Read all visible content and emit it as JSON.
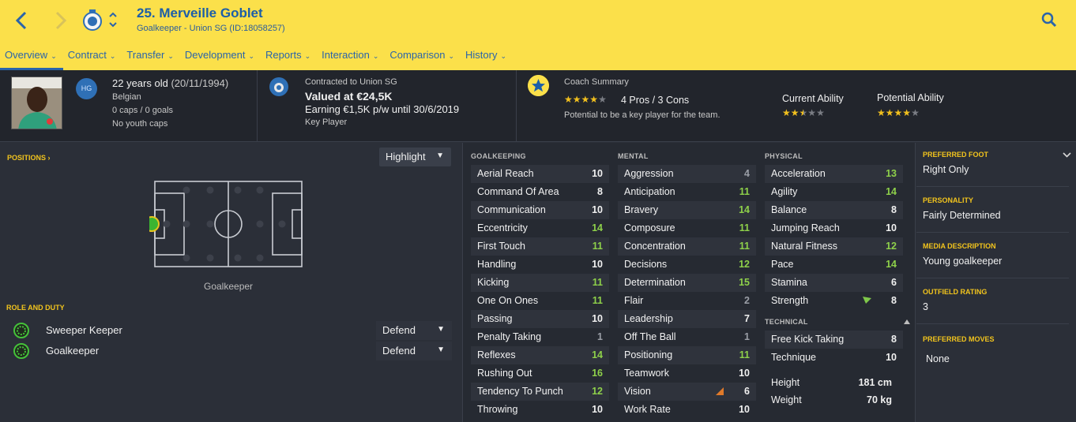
{
  "header": {
    "title": "25. Merveille Goblet",
    "subtitle": "Goalkeeper - Union SG (ID:18058257)",
    "tabs": [
      {
        "label": "Overview",
        "active": true
      },
      {
        "label": "Contract"
      },
      {
        "label": "Transfer"
      },
      {
        "label": "Development"
      },
      {
        "label": "Reports"
      },
      {
        "label": "Interaction"
      },
      {
        "label": "Comparison"
      },
      {
        "label": "History"
      }
    ],
    "accent": "#fbe04a"
  },
  "info": {
    "hg_badge": "HG",
    "age": "22 years old",
    "dob": "(20/11/1994)",
    "nationality": "Belgian",
    "caps": "0 caps / 0 goals",
    "youth_caps": "No youth caps",
    "contracted_to": "Contracted to Union SG",
    "value": "Valued at €24,5K",
    "earning": "Earning €1,5K p/w until 30/6/2019",
    "squad_status": "Key Player",
    "coach_summary_label": "Coach Summary",
    "coach_pros_cons": "4 Pros / 3 Cons",
    "coach_note": "Potential to be a key player for the team.",
    "coach_stars": 4,
    "current_ability_label": "Current Ability",
    "current_ability_stars": 2.5,
    "potential_ability_label": "Potential Ability",
    "potential_ability_stars": 4
  },
  "left": {
    "positions_label": "POSITIONS ›",
    "highlight_label": "Highlight",
    "position_name": "Goalkeeper",
    "role_label": "ROLE AND DUTY",
    "roles": [
      {
        "name": "Sweeper Keeper",
        "duty": "Defend"
      },
      {
        "name": "Goalkeeper",
        "duty": "Defend"
      }
    ]
  },
  "attributes": {
    "goalkeeping_label": "GOALKEEPING",
    "goalkeeping": [
      {
        "name": "Aerial Reach",
        "value": "10"
      },
      {
        "name": "Command Of Area",
        "value": "8"
      },
      {
        "name": "Communication",
        "value": "10"
      },
      {
        "name": "Eccentricity",
        "value": "14"
      },
      {
        "name": "First Touch",
        "value": "11"
      },
      {
        "name": "Handling",
        "value": "10"
      },
      {
        "name": "Kicking",
        "value": "11"
      },
      {
        "name": "One On Ones",
        "value": "11"
      },
      {
        "name": "Passing",
        "value": "10"
      },
      {
        "name": "Penalty Taking",
        "value": "1"
      },
      {
        "name": "Reflexes",
        "value": "14"
      },
      {
        "name": "Rushing Out",
        "value": "16"
      },
      {
        "name": "Tendency To Punch",
        "value": "12"
      },
      {
        "name": "Throwing",
        "value": "10"
      }
    ],
    "mental_label": "MENTAL",
    "mental": [
      {
        "name": "Aggression",
        "value": "4"
      },
      {
        "name": "Anticipation",
        "value": "11"
      },
      {
        "name": "Bravery",
        "value": "14"
      },
      {
        "name": "Composure",
        "value": "11"
      },
      {
        "name": "Concentration",
        "value": "11"
      },
      {
        "name": "Decisions",
        "value": "12"
      },
      {
        "name": "Determination",
        "value": "15"
      },
      {
        "name": "Flair",
        "value": "2"
      },
      {
        "name": "Leadership",
        "value": "7"
      },
      {
        "name": "Off The Ball",
        "value": "1"
      },
      {
        "name": "Positioning",
        "value": "11"
      },
      {
        "name": "Teamwork",
        "value": "10"
      },
      {
        "name": "Vision",
        "value": "6",
        "trend": "down"
      },
      {
        "name": "Work Rate",
        "value": "10"
      }
    ],
    "physical_label": "PHYSICAL",
    "physical": [
      {
        "name": "Acceleration",
        "value": "13"
      },
      {
        "name": "Agility",
        "value": "14"
      },
      {
        "name": "Balance",
        "value": "8"
      },
      {
        "name": "Jumping Reach",
        "value": "10"
      },
      {
        "name": "Natural Fitness",
        "value": "12"
      },
      {
        "name": "Pace",
        "value": "14"
      },
      {
        "name": "Stamina",
        "value": "6"
      },
      {
        "name": "Strength",
        "value": "8",
        "trend": "up"
      }
    ],
    "technical_label": "TECHNICAL",
    "technical": [
      {
        "name": "Free Kick Taking",
        "value": "8"
      },
      {
        "name": "Technique",
        "value": "10"
      }
    ],
    "height_label": "Height",
    "height": "181 cm",
    "weight_label": "Weight",
    "weight": "70 kg"
  },
  "right": {
    "preferred_foot_label": "PREFERRED FOOT",
    "preferred_foot": "Right Only",
    "personality_label": "PERSONALITY",
    "personality": "Fairly Determined",
    "media_label": "MEDIA DESCRIPTION",
    "media": "Young goalkeeper",
    "outfield_label": "OUTFIELD RATING",
    "outfield": "3",
    "moves_label": "PREFERRED MOVES",
    "moves": "None"
  }
}
